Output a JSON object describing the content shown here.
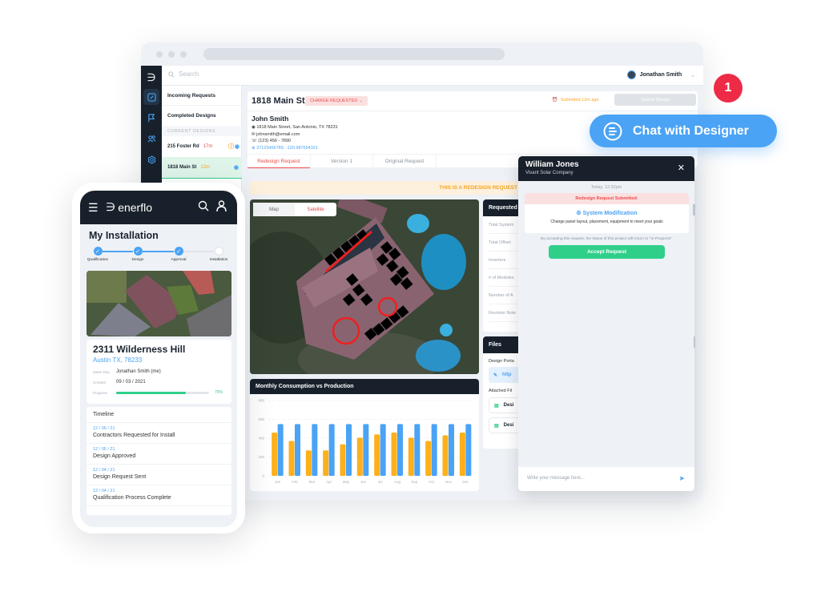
{
  "desktop": {
    "search_placeholder": "Search",
    "user_name": "Jonathan Smith",
    "left_list": {
      "incoming": "Incoming Requests",
      "completed": "Completed Designs",
      "section_label": "CURRENT DESIGNS",
      "designs": [
        {
          "name": "215 Foster Rd",
          "age": "17m",
          "age_color": "#ee4b4b"
        },
        {
          "name": "1818 Main St",
          "age": "12m",
          "age_color": "#f5a623"
        }
      ]
    },
    "project": {
      "title": "1818 Main St",
      "status": "CHANGE REQUESTED",
      "submitted": "Submitted 12m ago",
      "submit_button": "Submit Design",
      "customer": {
        "name": "John Smith",
        "address": "1818 Main Street, San Antonio, TX 78231",
        "email": "johnsmith@email.com",
        "phone": "(123) 456 - 7890",
        "coords": "37123456789, -120.987654321"
      },
      "tabs": [
        "Redesign Request",
        "Version 1",
        "Original Request"
      ],
      "active_tab": 0,
      "banner": "THIS IS A REDESIGN REQUEST",
      "map_toggle": [
        "Map",
        "Satellite"
      ],
      "map_active": 1
    },
    "requested": {
      "title": "Requested",
      "rows": [
        "Total System",
        "Total Offset",
        "Inverters",
        "# of Modules",
        "Number of A",
        "Revision Note"
      ]
    },
    "files": {
      "title": "Files",
      "design_portal_label": "Design Porta",
      "link_text": "http",
      "attached_label": "Attached Fil",
      "items": [
        "Desi",
        "Desi"
      ]
    }
  },
  "chart_data": {
    "type": "bar",
    "title": "Monthly Consumption vs Production",
    "categories": [
      "Jan",
      "Feb",
      "Mar",
      "Apr",
      "May",
      "Jun",
      "Jul",
      "Aug",
      "Sep",
      "Oct",
      "Nov",
      "Dec"
    ],
    "series": [
      {
        "name": "Consumption",
        "color": "#fdb01a",
        "values": [
          460,
          370,
          270,
          270,
          335,
          405,
          440,
          460,
          405,
          370,
          430,
          460
        ]
      },
      {
        "name": "Production",
        "color": "#4aa3f5",
        "values": [
          550,
          550,
          550,
          550,
          550,
          550,
          550,
          550,
          550,
          550,
          550,
          550
        ]
      }
    ],
    "yticks": [
      0,
      200,
      400,
      600,
      800
    ],
    "ylim": [
      0,
      800
    ],
    "xlabel": "",
    "ylabel": "",
    "grid": true
  },
  "notification_count": "1",
  "chat_button": "Chat with Designer",
  "chat": {
    "name": "William Jones",
    "company": "Vivant Solar Company",
    "timestamp": "Today, 12:32pm",
    "request_header": "Redesign Request Submitted:",
    "request_title": "System Modification",
    "request_desc": "Change panel layout, placement, equipment to meet your goals",
    "status_note": "By accepting this request, the status of this project will return to \"In-Progress\"",
    "accept_button": "Accept Request",
    "input_placeholder": "Write your message here..."
  },
  "phone": {
    "brand": "enerflo",
    "page_title": "My Installation",
    "steps": [
      {
        "label": "Qualification",
        "done": true
      },
      {
        "label": "Design",
        "done": true
      },
      {
        "label": "Approval",
        "done": true
      },
      {
        "label": "Installation",
        "done": false
      }
    ],
    "address": "2311 Wilderness Hill",
    "city": "Austin TX, 78233",
    "sales_rep_label": "Sales Rep",
    "sales_rep": "Jonathan Smith (me)",
    "created_label": "Created",
    "created": "09 / 03 / 2021",
    "progress_label": "Progress",
    "progress": "75%",
    "progress_value": 0.75,
    "timeline_title": "Timeline",
    "timeline": [
      {
        "date": "12 / 06 / 21",
        "event": "Contractors Requested for Install"
      },
      {
        "date": "12 / 05 / 21",
        "event": "Design Approved"
      },
      {
        "date": "12 / 04 / 21",
        "event": "Design Request Sent"
      },
      {
        "date": "12 / 04 / 21",
        "event": "Qualification Process Complete"
      }
    ]
  }
}
